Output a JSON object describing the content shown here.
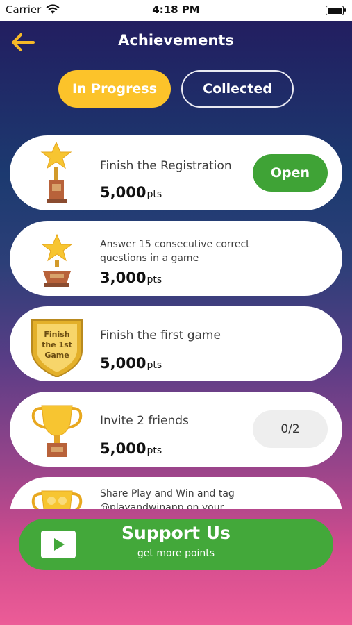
{
  "status_bar": {
    "carrier": "Carrier",
    "time": "4:18 PM"
  },
  "header": {
    "title": "Achievements"
  },
  "tabs": [
    {
      "label": "In Progress",
      "active": true
    },
    {
      "label": "Collected",
      "active": false
    }
  ],
  "achievements": [
    {
      "icon": "star-trophy-icon",
      "title": "Finish the Registration",
      "points": "5,000",
      "unit": "pts",
      "action": "Open"
    },
    {
      "icon": "star-trophy-icon",
      "title": "Answer 15 consecutive correct questions in a game",
      "points": "3,000",
      "unit": "pts"
    },
    {
      "icon": "shield-badge-icon",
      "badge_text": [
        "Finish",
        "the 1st",
        "Game"
      ],
      "title": "Finish the first game",
      "points": "5,000",
      "unit": "pts"
    },
    {
      "icon": "cup-trophy-icon",
      "title": "Invite 2 friends",
      "points": "5,000",
      "unit": "pts",
      "progress": "0/2"
    },
    {
      "icon": "social-cup-icon",
      "title": "Share Play and Win and tag @playandwinapp on your"
    }
  ],
  "support": {
    "title": "Support Us",
    "subtitle": "get more points",
    "icon": "play-icon"
  },
  "colors": {
    "accent": "#fcc32a",
    "green": "#3fa336",
    "text": "#3d3d3d"
  }
}
